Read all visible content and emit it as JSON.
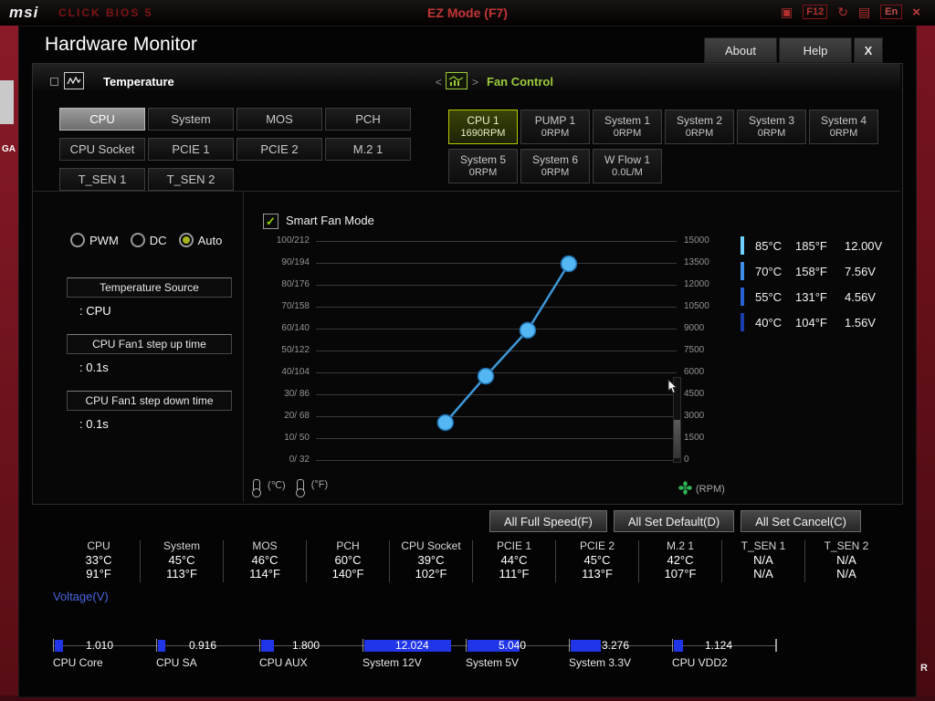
{
  "topbar": {
    "logo": "msi",
    "brand": "CLICK BIOS 5",
    "title": "EZ Mode (F7)",
    "hotkey": "F12",
    "lang": "En",
    "icons": {
      "snapshot": "▣",
      "refresh": "↻",
      "board": "▤",
      "close": "×"
    }
  },
  "edges": {
    "left_label": "GA",
    "right_label": "R"
  },
  "window": {
    "title": "Hardware Monitor",
    "about_label": "About",
    "help_label": "Help",
    "close_label": "X"
  },
  "temperature_section": {
    "title": "Temperature",
    "buttons": [
      {
        "label": "CPU",
        "selected": true
      },
      {
        "label": "System",
        "selected": false
      },
      {
        "label": "MOS",
        "selected": false
      },
      {
        "label": "PCH",
        "selected": false
      },
      {
        "label": "CPU Socket",
        "selected": false
      },
      {
        "label": "PCIE 1",
        "selected": false
      },
      {
        "label": "PCIE 2",
        "selected": false
      },
      {
        "label": "M.2 1",
        "selected": false
      },
      {
        "label": "T_SEN 1",
        "selected": false
      },
      {
        "label": "T_SEN 2",
        "selected": false
      }
    ]
  },
  "fan_section": {
    "title": "Fan Control",
    "prev_arrow": "<",
    "next_arrow": ">",
    "buttons": [
      {
        "name": "CPU 1",
        "value": "1690RPM",
        "selected": true
      },
      {
        "name": "PUMP 1",
        "value": "0RPM",
        "selected": false
      },
      {
        "name": "System 1",
        "value": "0RPM",
        "selected": false
      },
      {
        "name": "System 2",
        "value": "0RPM",
        "selected": false
      },
      {
        "name": "System 3",
        "value": "0RPM",
        "selected": false
      },
      {
        "name": "System 4",
        "value": "0RPM",
        "selected": false
      },
      {
        "name": "System 5",
        "value": "0RPM",
        "selected": false
      },
      {
        "name": "System 6",
        "value": "0RPM",
        "selected": false
      },
      {
        "name": "W Flow 1",
        "value": "0.0L/M",
        "selected": false
      }
    ]
  },
  "controls": {
    "mode_options": [
      {
        "label": "PWM",
        "selected": false
      },
      {
        "label": "DC",
        "selected": false
      },
      {
        "label": "Auto",
        "selected": true
      }
    ],
    "fields": [
      {
        "label": "Temperature Source",
        "value": ": CPU"
      },
      {
        "label": "CPU Fan1 step up time",
        "value": ": 0.1s"
      },
      {
        "label": "CPU Fan1 step down time",
        "value": ": 0.1s"
      }
    ]
  },
  "smart_fan": {
    "label": "Smart Fan Mode",
    "checked": true,
    "check_glyph": "✓"
  },
  "chart_data": {
    "type": "line",
    "title": "Smart Fan Mode",
    "left_axis": {
      "label": "Temperature ℃/°F",
      "ticks": [
        "100/212",
        "90/194",
        "80/176",
        "70/158",
        "60/140",
        "50/122",
        "40/104",
        "30/ 86",
        "20/ 68",
        "10/ 50",
        "0/ 32"
      ]
    },
    "right_axis": {
      "label": "RPM",
      "range": [
        0,
        15000
      ],
      "ticks": [
        "15000",
        "13500",
        "12000",
        "10500",
        "9000",
        "7500",
        "6000",
        "4500",
        "3000",
        "1500",
        "0"
      ]
    },
    "captions": {
      "celsius": "(℃)",
      "fahrenheit": "(°F)",
      "rpm": "(RPM)"
    },
    "grid": true,
    "legend_position": "right",
    "line_color": "#3f97d8",
    "point_color": "#54b6f2",
    "point_stroke": "#1d6fae",
    "points": [
      {
        "temp_c": 40,
        "temp_f": 104,
        "voltage": 1.56,
        "x_pct": 35.9,
        "y_pct": 82.9
      },
      {
        "temp_c": 55,
        "temp_f": 131,
        "voltage": 4.56,
        "x_pct": 47.1,
        "y_pct": 61.7
      },
      {
        "temp_c": 70,
        "temp_f": 158,
        "voltage": 7.56,
        "x_pct": 58.7,
        "y_pct": 40.8
      },
      {
        "temp_c": 85,
        "temp_f": 185,
        "voltage": 12.0,
        "x_pct": 70.1,
        "y_pct": 10.4
      }
    ]
  },
  "legend": {
    "rows": [
      {
        "color": "#6fd1ff",
        "temp_c": "85°C",
        "temp_f": "185°F",
        "voltage": "12.00V"
      },
      {
        "color": "#3e8ee8",
        "temp_c": "70°C",
        "temp_f": "158°F",
        "voltage": "7.56V"
      },
      {
        "color": "#2a62d4",
        "temp_c": "55°C",
        "temp_f": "131°F",
        "voltage": "4.56V"
      },
      {
        "color": "#1b3eae",
        "temp_c": "40°C",
        "temp_f": "104°F",
        "voltage": "1.56V"
      }
    ]
  },
  "actions": [
    {
      "label": "All Full Speed(F)"
    },
    {
      "label": "All Set Default(D)"
    },
    {
      "label": "All Set Cancel(C)"
    }
  ],
  "sensors": {
    "items": [
      {
        "name": "CPU",
        "c": "33°C",
        "f": "91°F"
      },
      {
        "name": "System",
        "c": "45°C",
        "f": "113°F"
      },
      {
        "name": "MOS",
        "c": "46°C",
        "f": "114°F"
      },
      {
        "name": "PCH",
        "c": "60°C",
        "f": "140°F"
      },
      {
        "name": "CPU Socket",
        "c": "39°C",
        "f": "102°F"
      },
      {
        "name": "PCIE 1",
        "c": "44°C",
        "f": "111°F"
      },
      {
        "name": "PCIE 2",
        "c": "45°C",
        "f": "113°F"
      },
      {
        "name": "M.2 1",
        "c": "42°C",
        "f": "107°F"
      },
      {
        "name": "T_SEN 1",
        "c": "N/A",
        "f": "N/A"
      },
      {
        "name": "T_SEN 2",
        "c": "N/A",
        "f": "N/A"
      }
    ]
  },
  "voltage": {
    "title": "Voltage(V)",
    "items": [
      {
        "name": "CPU Core",
        "value": "1.010",
        "fill_pct": 8
      },
      {
        "name": "CPU SA",
        "value": "0.916",
        "fill_pct": 7
      },
      {
        "name": "CPU AUX",
        "value": "1.800",
        "fill_pct": 13
      },
      {
        "name": "System 12V",
        "value": "12.024",
        "fill_pct": 87
      },
      {
        "name": "System 5V",
        "value": "5.040",
        "fill_pct": 52
      },
      {
        "name": "System 3.3V",
        "value": "3.276",
        "fill_pct": 30
      },
      {
        "name": "CPU VDD2",
        "value": "1.124",
        "fill_pct": 9
      }
    ]
  }
}
